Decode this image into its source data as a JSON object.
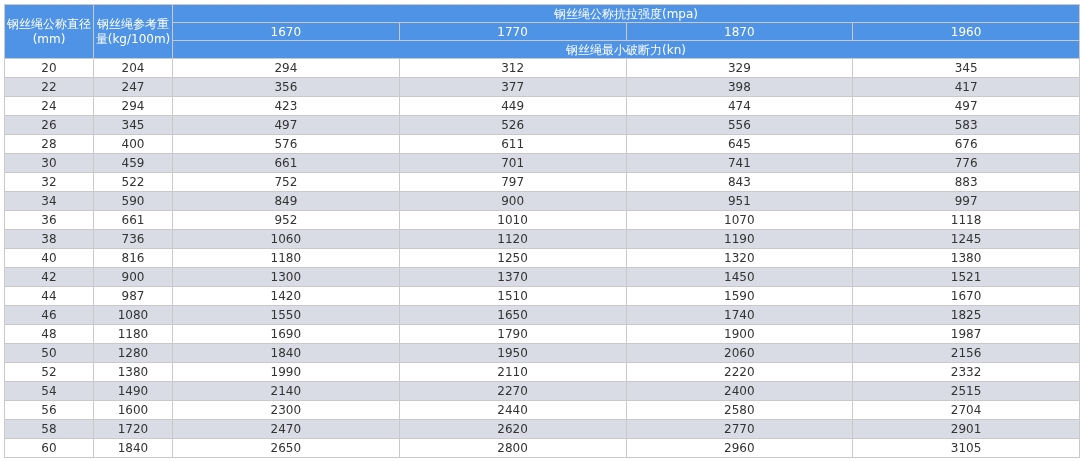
{
  "table": {
    "diameter_header": "钢丝绳公称直径(mm)",
    "weight_header": "钢丝绳参考重量(kg/100m)",
    "strength_header": "钢丝绳公称抗拉强度(mpa)",
    "strength_grades": [
      "1670",
      "1770",
      "1870",
      "1960"
    ],
    "force_header": "钢丝绳最小破断力(kn)",
    "rows": [
      [
        "20",
        "204",
        "294",
        "312",
        "329",
        "345"
      ],
      [
        "22",
        "247",
        "356",
        "377",
        "398",
        "417"
      ],
      [
        "24",
        "294",
        "423",
        "449",
        "474",
        "497"
      ],
      [
        "26",
        "345",
        "497",
        "526",
        "556",
        "583"
      ],
      [
        "28",
        "400",
        "576",
        "611",
        "645",
        "676"
      ],
      [
        "30",
        "459",
        "661",
        "701",
        "741",
        "776"
      ],
      [
        "32",
        "522",
        "752",
        "797",
        "843",
        "883"
      ],
      [
        "34",
        "590",
        "849",
        "900",
        "951",
        "997"
      ],
      [
        "36",
        "661",
        "952",
        "1010",
        "1070",
        "1118"
      ],
      [
        "38",
        "736",
        "1060",
        "1120",
        "1190",
        "1245"
      ],
      [
        "40",
        "816",
        "1180",
        "1250",
        "1320",
        "1380"
      ],
      [
        "42",
        "900",
        "1300",
        "1370",
        "1450",
        "1521"
      ],
      [
        "44",
        "987",
        "1420",
        "1510",
        "1590",
        "1670"
      ],
      [
        "46",
        "1080",
        "1550",
        "1650",
        "1740",
        "1825"
      ],
      [
        "48",
        "1180",
        "1690",
        "1790",
        "1900",
        "1987"
      ],
      [
        "50",
        "1280",
        "1840",
        "1950",
        "2060",
        "2156"
      ],
      [
        "52",
        "1380",
        "1990",
        "2110",
        "2220",
        "2332"
      ],
      [
        "54",
        "1490",
        "2140",
        "2270",
        "2400",
        "2515"
      ],
      [
        "56",
        "1600",
        "2300",
        "2440",
        "2580",
        "2704"
      ],
      [
        "58",
        "1720",
        "2470",
        "2620",
        "2770",
        "2901"
      ],
      [
        "60",
        "1840",
        "2650",
        "2800",
        "2960",
        "3105"
      ]
    ]
  }
}
